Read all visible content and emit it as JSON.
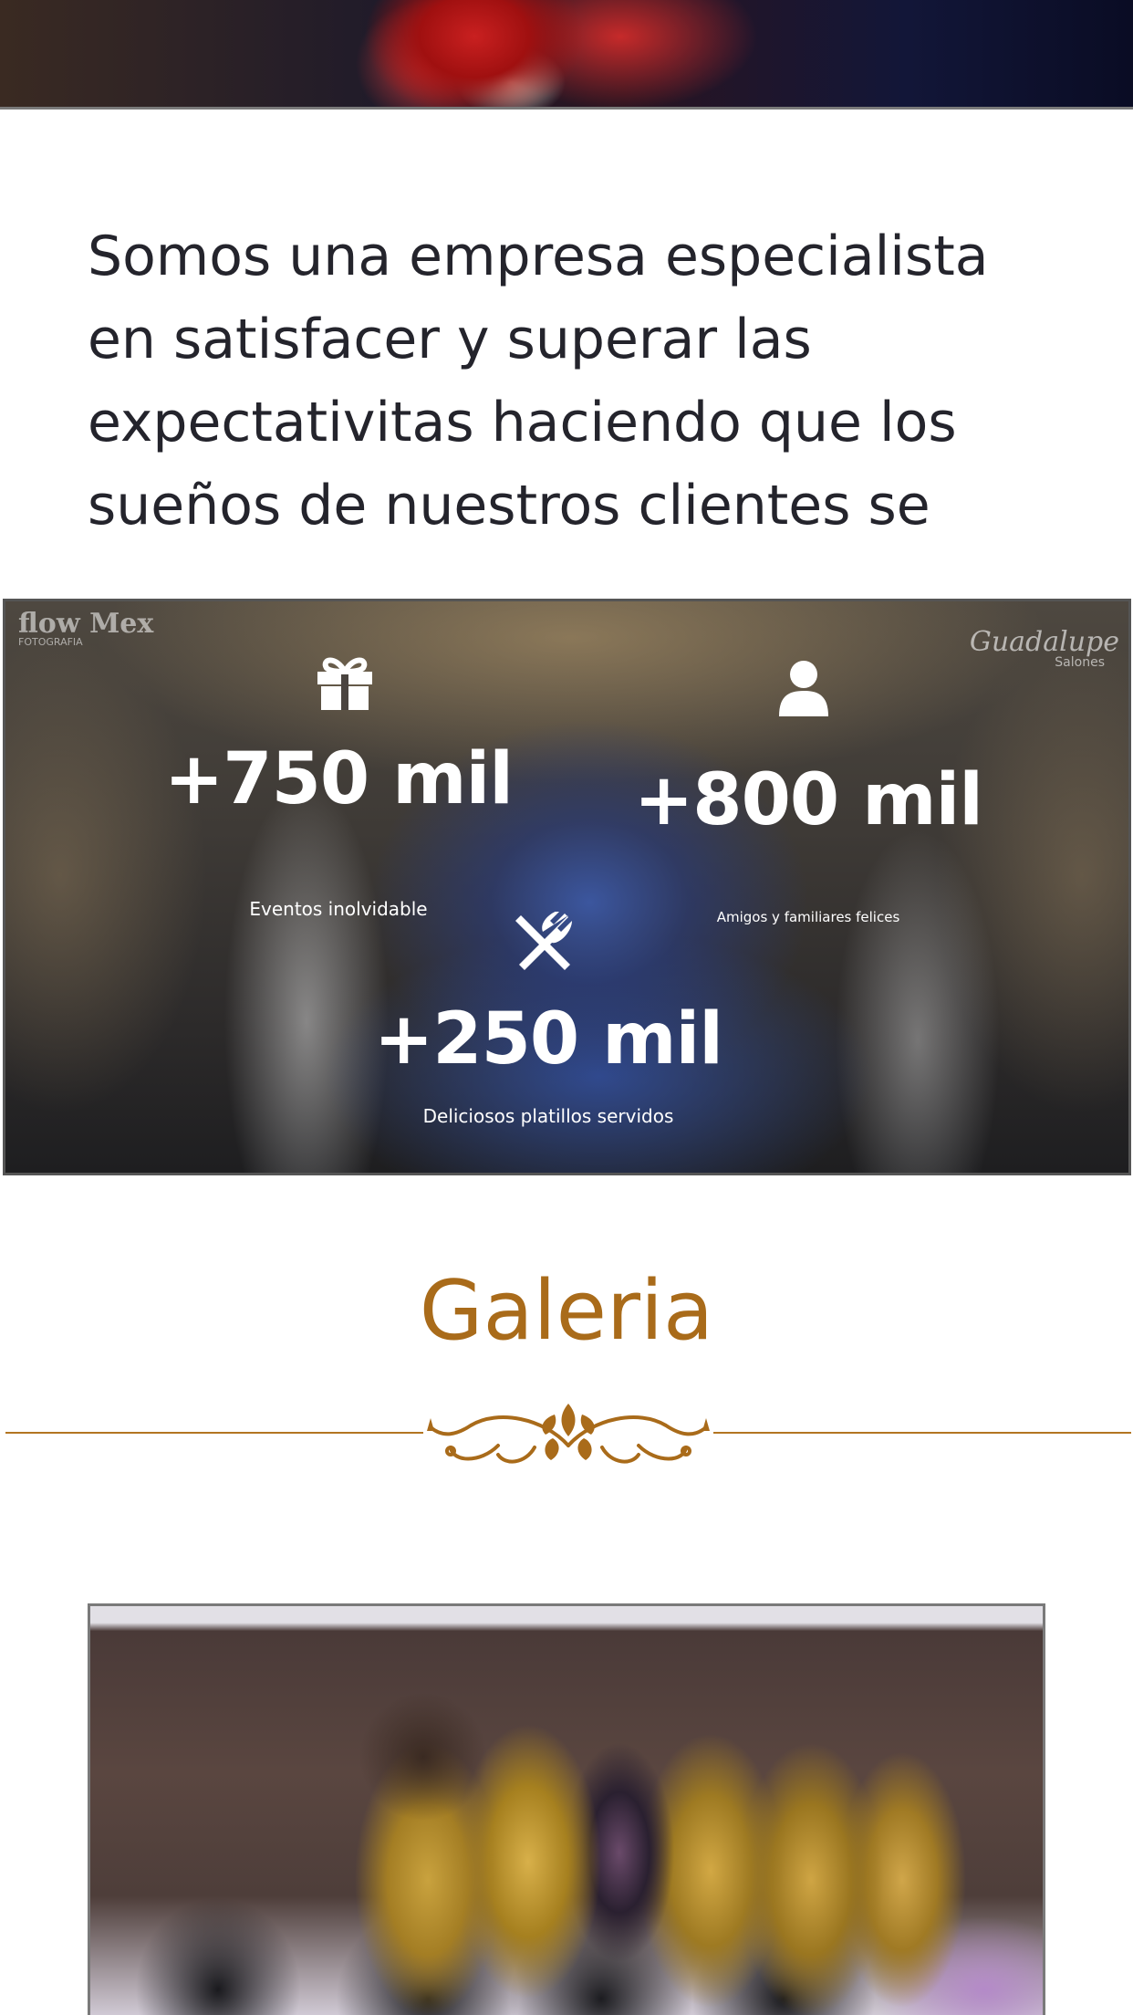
{
  "intro": {
    "text": "Somos una empresa especialista en satisfacer y superar las expectativitas haciendo que los sueños de nuestros clientes se"
  },
  "stats_banner": {
    "watermark_left": "flow Mex",
    "watermark_left_sub": "FOTOGRAFIA",
    "watermark_right": "Guadalupe",
    "watermark_right_sub": "Salones",
    "items": [
      {
        "icon": "gift-icon",
        "value": "+750 mil",
        "label": "Eventos inolvidable"
      },
      {
        "icon": "user-icon",
        "value": "+800 mil",
        "label": "Amigos y familiares felices"
      },
      {
        "icon": "utensils-icon",
        "value": "+250 mil",
        "label": "Deliciosos platillos servidos"
      }
    ]
  },
  "gallery": {
    "title": "Galeria",
    "accent_color": "#a96b1a"
  },
  "colors": {
    "text_dark": "#24242c",
    "accent": "#a96b1a",
    "white": "#ffffff"
  }
}
